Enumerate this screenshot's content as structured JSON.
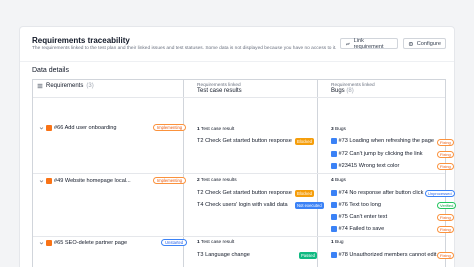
{
  "header": {
    "title": "Requirements traceability",
    "description": "The requirements linked to the test plan and their linked issues and test statuses. Some data is not displayed because you have no access to it.",
    "link_button": "Link requirement",
    "configure_button": "Configure"
  },
  "section": {
    "title": "Data details"
  },
  "columns": {
    "requirements": {
      "name": "Requirements",
      "count": "(3)"
    },
    "test_results": {
      "label": "Requirements linked",
      "name": "Test case results"
    },
    "bugs": {
      "label": "Requirements linked",
      "name": "Bugs",
      "count": "(8)"
    }
  },
  "colors": {
    "implementing": "#ea580c",
    "unstarted": "#2563eb",
    "blocked": "#f59e0b",
    "not_executed": "#3b82f6",
    "passed": "#10b981"
  },
  "rows": [
    {
      "requirement": {
        "title": "#66 Add user onboarding",
        "status": "Implementing"
      },
      "test_count": "1",
      "test_suffix": "Test case result",
      "tests": [
        {
          "title": "T2 Check Get started button response",
          "status": "Blocked"
        }
      ],
      "bug_count": "3",
      "bug_suffix": "Bugs",
      "bugs": [
        {
          "title": "#73 Loading when refreshing the page",
          "status": "Fixing"
        },
        {
          "title": "#72 Can't jump by clicking the link",
          "status": "Fixing"
        },
        {
          "title": "#23415 Wrong text color",
          "status": "Fixing"
        }
      ]
    },
    {
      "requirement": {
        "title": "#49 Website homepage local...",
        "status": "Implementing"
      },
      "test_count": "2",
      "test_suffix": "Test case results",
      "tests": [
        {
          "title": "T2 Check Get started button response",
          "status": "Blocked"
        },
        {
          "title": "T4 Check users' login with valid data",
          "status": "Not executed"
        }
      ],
      "bug_count": "4",
      "bug_suffix": "Bugs",
      "bugs": [
        {
          "title": "#74 No response after button click",
          "status": "Unprocessed"
        },
        {
          "title": "#76 Text too long",
          "status": "Verified"
        },
        {
          "title": "#75 Can't enter text",
          "status": "Fixing"
        },
        {
          "title": "#74 Failed to save",
          "status": "Fixing"
        }
      ]
    },
    {
      "requirement": {
        "title": "#65 SEO-delete partner page",
        "status": "Unstarted"
      },
      "test_count": "1",
      "test_suffix": "Test case result",
      "tests": [
        {
          "title": "T3 Language change",
          "status": "Passed"
        }
      ],
      "bug_count": "1",
      "bug_suffix": "Bug",
      "bugs": [
        {
          "title": "#78 Unauthorized members cannot edit",
          "status": "Fixing"
        }
      ]
    }
  ]
}
